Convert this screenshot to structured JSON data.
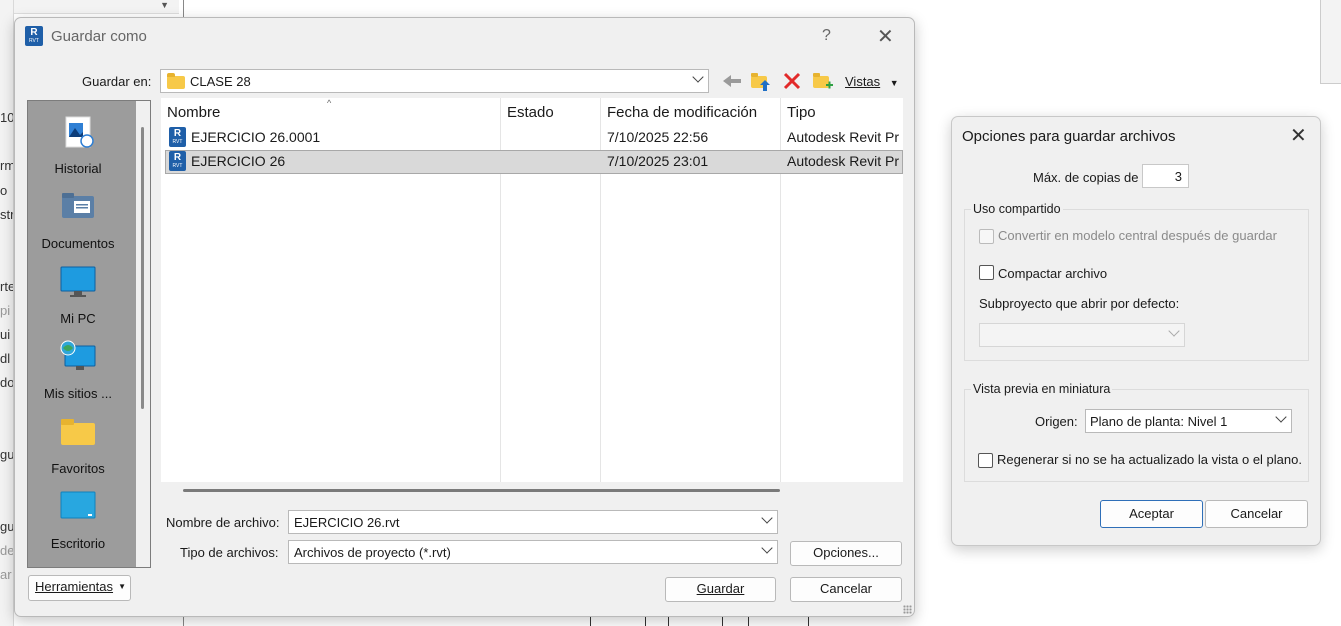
{
  "background": {
    "left_fragments": [
      "10",
      "rm",
      "o",
      "str",
      "rte",
      "pi",
      "ui",
      "dl",
      "do",
      "gu",
      "gu",
      "de",
      "ar"
    ]
  },
  "save_dialog": {
    "title": "Guardar como",
    "help_glyph": "?",
    "close_glyph": "✕",
    "save_in_label": "Guardar en:",
    "save_in_value": "CLASE 28",
    "views_label": "Vistas",
    "places": [
      {
        "label": "Historial",
        "icon": "history-icon"
      },
      {
        "label": "Documentos",
        "icon": "documents-icon"
      },
      {
        "label": "Mi PC",
        "icon": "computer-icon"
      },
      {
        "label": "Mis sitios ...",
        "icon": "network-places-icon"
      },
      {
        "label": "Favoritos",
        "icon": "favorites-folder-icon"
      },
      {
        "label": "Escritorio",
        "icon": "desktop-icon"
      }
    ],
    "columns": [
      "Nombre",
      "Estado",
      "Fecha de modificación",
      "Tipo"
    ],
    "files": [
      {
        "name": "EJERCICIO 26.0001",
        "status": "",
        "modified": "7/10/2025 22:56",
        "type": "Autodesk Revit Pr",
        "selected": false
      },
      {
        "name": "EJERCICIO 26",
        "status": "",
        "modified": "7/10/2025 23:01",
        "type": "Autodesk Revit Pr",
        "selected": true
      }
    ],
    "filename_label": "Nombre de archivo:",
    "filename_value": "EJERCICIO 26.rvt",
    "filetype_label": "Tipo de archivos:",
    "filetype_value": "Archivos de proyecto (*.rvt)",
    "options_button": "Opciones...",
    "save_button": "Guardar",
    "cancel_button": "Cancelar",
    "tools_button": "Herramientas"
  },
  "options_dialog": {
    "title": "Opciones para guardar archivos",
    "close_glyph": "✕",
    "max_copies_label": "Máx. de copias de",
    "max_copies_value": "3",
    "worksharing_group": "Uso compartido",
    "make_central_label": "Convertir en modelo central después de guardar",
    "make_central_checked": false,
    "compact_label": "Compactar archivo",
    "compact_checked": false,
    "open_workset_label": "Subproyecto que abrir por defecto:",
    "open_workset_value": "",
    "thumbnail_group": "Vista previa en miniatura",
    "source_label": "Origen:",
    "source_value": "Plano de planta: Nivel 1",
    "regenerate_label": "Regenerar si no se ha actualizado la vista o el plano.",
    "regenerate_checked": false,
    "ok_button": "Aceptar",
    "cancel_button": "Cancelar"
  },
  "colors": {
    "revit_blue": "#1f5fa8",
    "delete_red": "#e22a2a",
    "folder_yellow": "#f7c948",
    "primary_border": "#2f6fb8"
  }
}
